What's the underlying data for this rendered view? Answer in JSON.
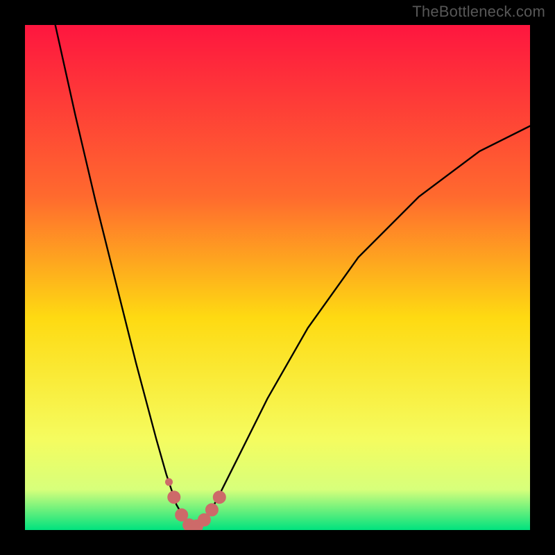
{
  "watermark": "TheBottleneck.com",
  "colors": {
    "frame_bg": "#000000",
    "gradient_top": "#fe163f",
    "gradient_upper_mid": "#ff6a2e",
    "gradient_mid": "#feda12",
    "gradient_low": "#f5fc5f",
    "gradient_green_top": "#d7ff7b",
    "gradient_green_bottom": "#00e27e",
    "curve": "#000000",
    "marker_fill": "#cd6a69",
    "marker_stroke": "#cd6a69"
  },
  "chart_data": {
    "type": "line",
    "title": "",
    "xlabel": "",
    "ylabel": "",
    "xlim": [
      0,
      100
    ],
    "ylim": [
      0,
      100
    ],
    "notes": "Plot area has no visible axis ticks or labels. Background is a vertical rainbow gradient from red (top) through orange/yellow to bright green (bottom). A single black V-shaped curve dips to near y≈0 around x≈33. A set of thick rose-colored markers highlight the curve near its minimum.",
    "series": [
      {
        "name": "bottleneck-curve",
        "color": "#000000",
        "x": [
          6,
          10,
          14,
          18,
          22,
          26,
          28,
          30,
          32,
          33,
          34,
          36,
          38,
          42,
          48,
          56,
          66,
          78,
          90,
          100
        ],
        "y": [
          100,
          82,
          65,
          49,
          33,
          18,
          11,
          5,
          1.5,
          0.3,
          0.7,
          2.5,
          6,
          14,
          26,
          40,
          54,
          66,
          75,
          80
        ]
      }
    ],
    "markers": {
      "name": "optimum-markers",
      "color": "#cd6a69",
      "x": [
        28.5,
        29.5,
        31,
        32.5,
        34,
        35.5,
        37,
        38.5
      ],
      "y": [
        9.5,
        6.5,
        3,
        1,
        0.8,
        2,
        4,
        6.5
      ],
      "radius_px": [
        5,
        9,
        9,
        9,
        9,
        9,
        9,
        9
      ]
    }
  }
}
